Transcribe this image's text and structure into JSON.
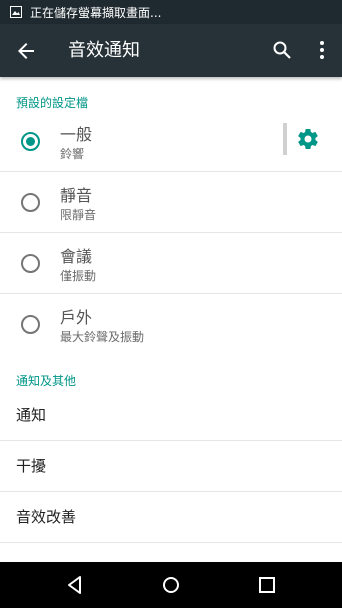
{
  "status_bar": {
    "notification_text": "正在儲存螢幕擷取畫面...",
    "icon": "image-icon"
  },
  "app_bar": {
    "title": "音效通知",
    "back_icon": "arrow-back-icon",
    "search_icon": "search-icon",
    "more_icon": "more-vert-icon"
  },
  "profiles_section": {
    "header": "預設的設定檔",
    "items": [
      {
        "title": "一般",
        "subtitle": "鈴響",
        "selected": true
      },
      {
        "title": "靜音",
        "subtitle": "限靜音",
        "selected": false
      },
      {
        "title": "會議",
        "subtitle": "僅振動",
        "selected": false
      },
      {
        "title": "戶外",
        "subtitle": "最大鈴聲及振動",
        "selected": false
      }
    ]
  },
  "other_section": {
    "header": "通知及其他",
    "items": [
      {
        "label": "通知"
      },
      {
        "label": "干擾"
      },
      {
        "label": "音效改善"
      }
    ]
  },
  "colors": {
    "accent": "#009688",
    "app_bar": "#263238",
    "status_bar": "#1f2a30",
    "nav_bar": "#000000"
  },
  "nav_bar": {
    "back_icon": "nav-back-icon",
    "home_icon": "nav-home-icon",
    "recents_icon": "nav-recents-icon"
  }
}
